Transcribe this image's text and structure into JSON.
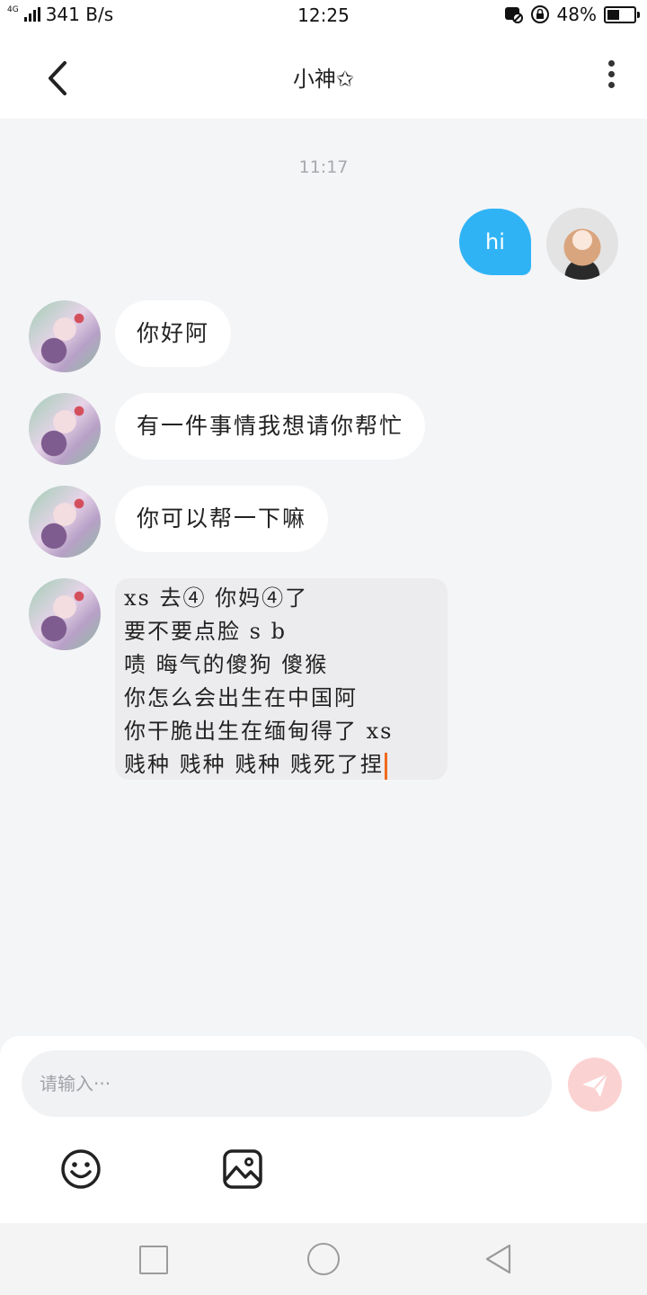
{
  "status_bar": {
    "network_type": "4G",
    "speed": "341 B/s",
    "time": "12:25",
    "battery": "48%",
    "battery_level": 0.48
  },
  "header": {
    "title": "小神✩",
    "back_icon": "chevron-left-icon",
    "more_icon": "more-vertical-icon"
  },
  "chat": {
    "timestamp": "11:17",
    "self_message": "hi",
    "peer_messages": [
      "你好阿",
      "有一件事情我想请你帮忙",
      "你可以帮一下嘛"
    ],
    "draft_lines": [
      "xs 去④ 你妈④了",
      "要不要点脸 s b",
      "啧 晦气的傻狗 傻猴",
      "你怎么会出生在中国阿",
      "你干脆出生在缅甸得了 xs",
      "贱种 贱种 贱种 贱死了捏"
    ]
  },
  "input": {
    "placeholder": "请输入···",
    "send_icon": "send-icon",
    "emoji_icon": "smiley-icon",
    "image_icon": "image-icon"
  },
  "colors": {
    "self_bubble": "#2fb3f5",
    "send_button": "#fbd2d2",
    "caret": "#f06a1c"
  }
}
